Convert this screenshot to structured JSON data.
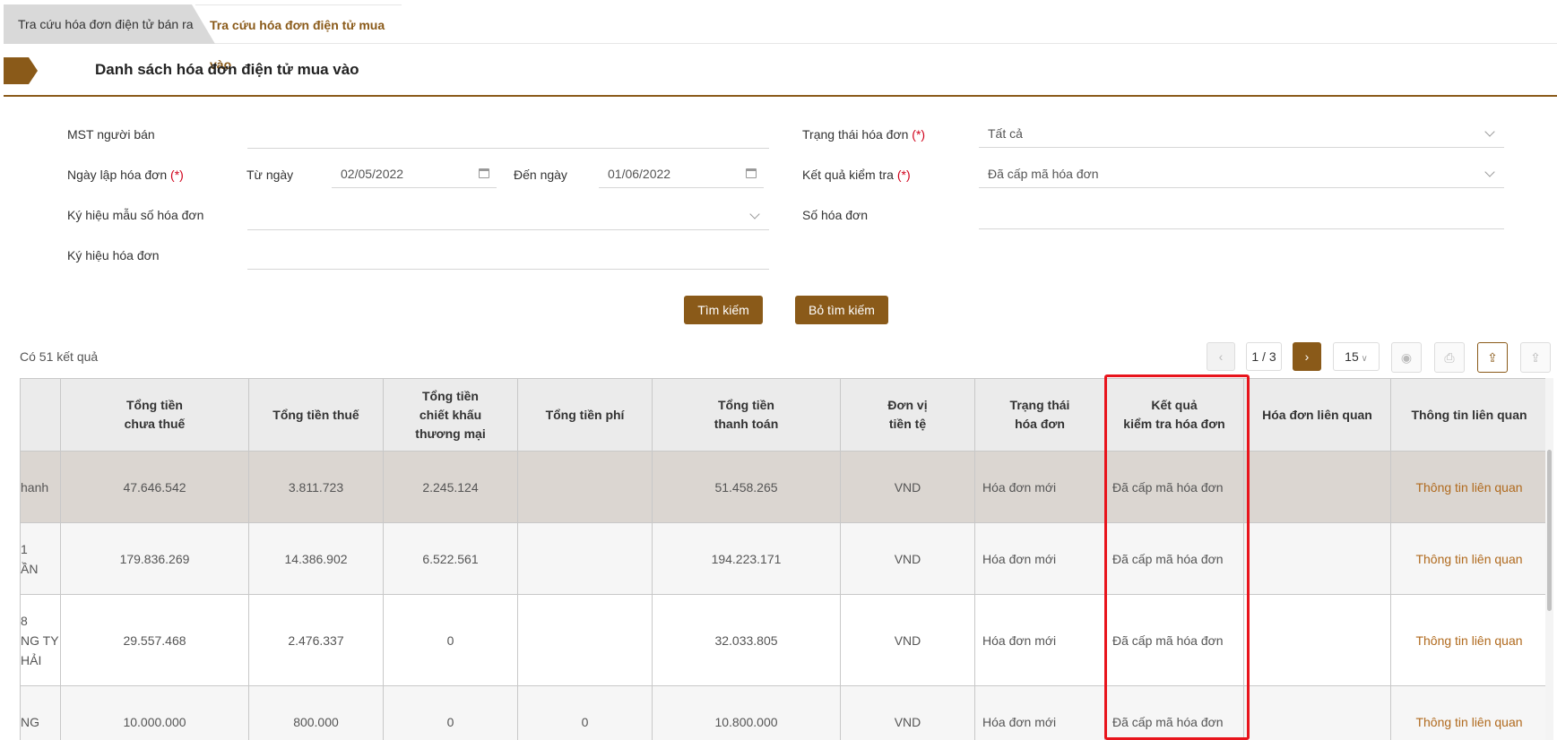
{
  "tabs": [
    {
      "label": "Tra cứu hóa đơn điện tử bán ra"
    },
    {
      "label": "Tra cứu hóa đơn điện tử mua vào"
    }
  ],
  "section_title": "Danh sách hóa đơn điện tử mua vào",
  "form": {
    "mst_label": "MST người bán",
    "mst_value": "",
    "ngay_lap_label": "Ngày lập hóa đơn",
    "required_mark": "(*)",
    "tu_ngay_label": "Từ ngày",
    "tu_ngay_value": "02/05/2022",
    "den_ngay_label": "Đến ngày",
    "den_ngay_value": "01/06/2022",
    "ky_hieu_mau_label": "Ký hiệu mẫu số hóa đơn",
    "ky_hieu_mau_value": "",
    "ky_hieu_hd_label": "Ký hiệu hóa đơn",
    "ky_hieu_hd_value": "",
    "trang_thai_label": "Trạng thái hóa đơn",
    "trang_thai_value": "Tất cả",
    "ket_qua_label": "Kết quả kiểm tra",
    "ket_qua_value": "Đã cấp mã hóa đơn",
    "so_hd_label": "Số hóa đơn",
    "so_hd_value": ""
  },
  "buttons": {
    "search": "Tìm kiếm",
    "clear": "Bỏ tìm kiếm"
  },
  "result_count": "Có 51 kết quả",
  "pager": {
    "prev": "‹",
    "page": "1 / 3",
    "next": "›",
    "size": "15"
  },
  "toolbar_icons": [
    "view-icon",
    "print-icon",
    "export-icon",
    "export-all-icon"
  ],
  "table": {
    "headers": [
      "",
      "Tổng tiền\nchưa thuế",
      "Tổng tiền thuế",
      "Tổng tiền\nchiết khấu\nthương mại",
      "Tổng tiền phí",
      "Tổng tiền\nthanh toán",
      "Đơn vị\ntiền tệ",
      "Trạng thái\nhóa đơn",
      "Kết quả\nkiểm tra hóa đơn",
      "Hóa đơn liên quan",
      "Thông tin liên quan"
    ],
    "rows": [
      [
        "hanh",
        "47.646.542",
        "3.811.723",
        "2.245.124",
        "",
        "51.458.265",
        "VND",
        "Hóa đơn mới",
        "Đã cấp mã hóa đơn",
        "",
        "Thông tin liên quan"
      ],
      [
        "1\nẦN",
        "179.836.269",
        "14.386.902",
        "6.522.561",
        "",
        "194.223.171",
        "VND",
        "Hóa đơn mới",
        "Đã cấp mã hóa đơn",
        "",
        "Thông tin liên quan"
      ],
      [
        "8\nNG TY\nHẢI",
        "29.557.468",
        "2.476.337",
        "0",
        "",
        "32.033.805",
        "VND",
        "Hóa đơn mới",
        "Đã cấp mã hóa đơn",
        "",
        "Thông tin liên quan"
      ],
      [
        "NG",
        "10.000.000",
        "800.000",
        "0",
        "0",
        "10.800.000",
        "VND",
        "Hóa đơn mới",
        "Đã cấp mã hóa đơn",
        "",
        "Thông tin liên quan"
      ]
    ]
  },
  "colors": {
    "brand": "#8a5a19",
    "highlight": "#e8141c",
    "required": "#d0021b"
  }
}
